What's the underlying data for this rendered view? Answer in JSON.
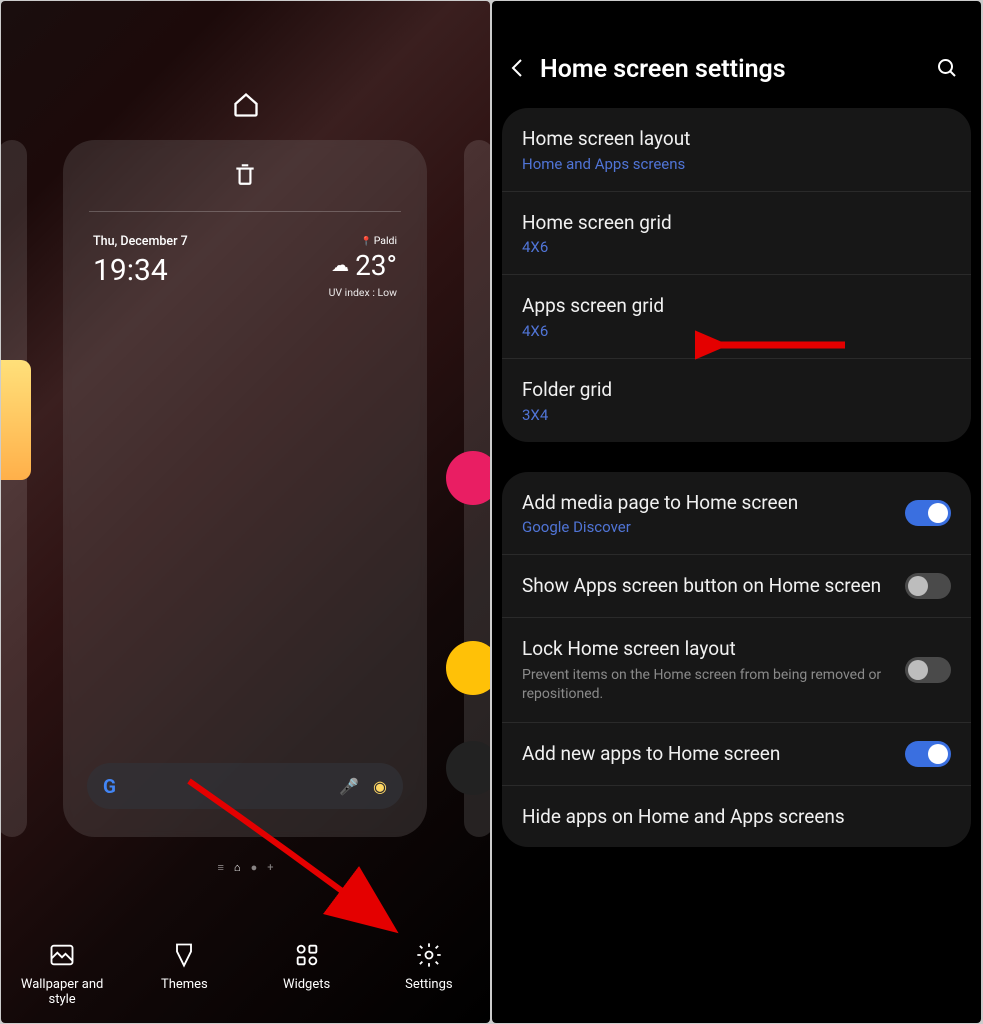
{
  "left": {
    "date": "Thu, December 7",
    "time": "19:34",
    "location": "Paldi",
    "temperature": "23°",
    "uv": "UV index : Low",
    "bottom_tabs": {
      "wallpaper": "Wallpaper and style",
      "themes": "Themes",
      "widgets": "Widgets",
      "settings": "Settings"
    }
  },
  "right": {
    "title": "Home screen settings",
    "group1": {
      "layout_title": "Home screen layout",
      "layout_sub": "Home and Apps screens",
      "home_grid_title": "Home screen grid",
      "home_grid_sub": "4X6",
      "apps_grid_title": "Apps screen grid",
      "apps_grid_sub": "4X6",
      "folder_grid_title": "Folder grid",
      "folder_grid_sub": "3X4"
    },
    "group2": {
      "media_title": "Add media page to Home screen",
      "media_sub": "Google Discover",
      "media_on": true,
      "show_apps_title": "Show Apps screen button on Home screen",
      "show_apps_on": false,
      "lock_title": "Lock Home screen layout",
      "lock_desc": "Prevent items on the Home screen from being removed or repositioned.",
      "lock_on": false,
      "newapps_title": "Add new apps to Home screen",
      "newapps_on": true,
      "hide_title": "Hide apps on Home and Apps screens"
    }
  }
}
